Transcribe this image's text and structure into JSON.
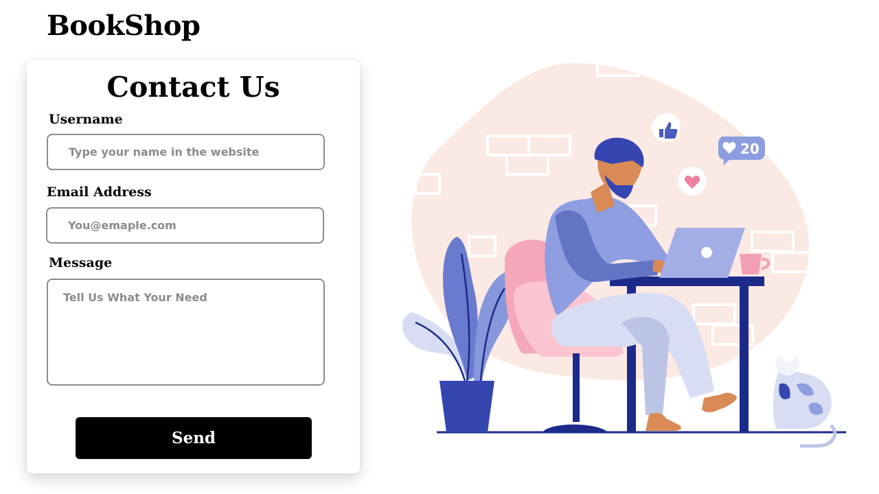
{
  "app": {
    "brand": "BookShop"
  },
  "contact_form": {
    "title": "Contact Us",
    "username": {
      "label": "Username",
      "placeholder": "Type your name in the website",
      "value": ""
    },
    "email": {
      "label": "Email Address",
      "placeholder": "You@emaple.com",
      "value": ""
    },
    "message": {
      "label": "Message",
      "placeholder": "Tell Us What Your Need",
      "value": ""
    },
    "send_label": "Send"
  },
  "illustration": {
    "likes_count": "20",
    "icons": [
      "thumbs-up-icon",
      "heart-icon",
      "heart-count-icon"
    ]
  },
  "colors": {
    "button_bg": "#000000",
    "button_text": "#ffffff",
    "field_border": "#8c8c8c",
    "placeholder": "#8b8b8b",
    "blob": "#fbe9e4",
    "navy": "#1c2a8a",
    "periwinkle": "#7f8ed6",
    "pink": "#f7a9bd"
  }
}
